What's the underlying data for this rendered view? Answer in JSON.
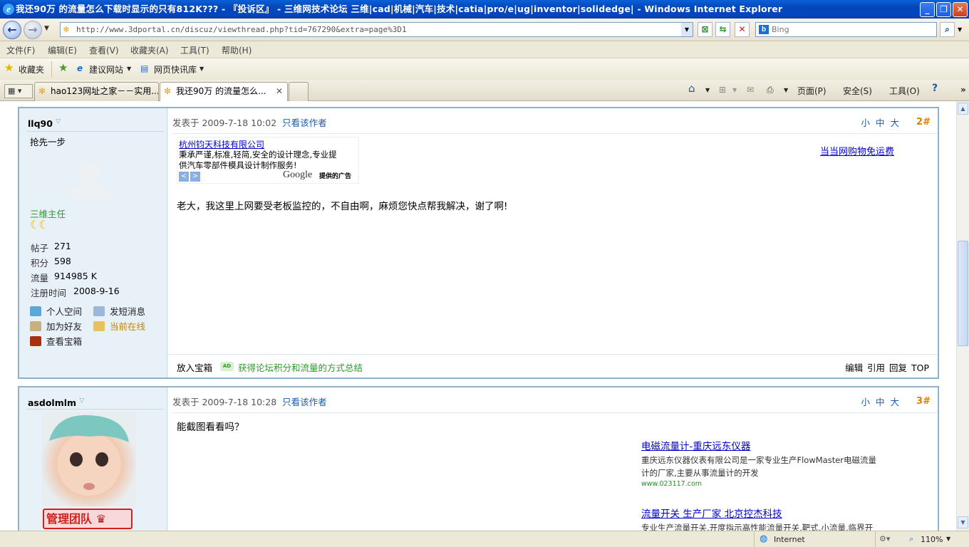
{
  "window": {
    "title": "我还90万 的流量怎么下载时显示的只有812K??? - 『投诉区』 - 三维网技术论坛 三维|cad|机械|汽车|技术|catia|pro/e|ug|inventor|solidedge| - Windows Internet Explorer",
    "min": "_",
    "restore": "❐",
    "close": "✕"
  },
  "address": {
    "url": "http://www.3dportal.cn/discuz/viewthread.php?tid=767290&extra=page%3D1",
    "search_placeholder": "Bing",
    "search_icon": "magnifier-icon"
  },
  "menu": [
    "文件(F)",
    "编辑(E)",
    "查看(V)",
    "收藏夹(A)",
    "工具(T)",
    "帮助(H)"
  ],
  "favbar": {
    "favorites": "收藏夹",
    "suggested": "建议网站",
    "slices": "网页快讯库"
  },
  "tabs": [
    {
      "label": "hao123网址之家－－实用..."
    },
    {
      "label": "我还90万 的流量怎么..."
    }
  ],
  "commands": {
    "page": "页面(P)",
    "safety": "安全(S)",
    "tools": "工具(O)"
  },
  "posts": [
    {
      "author": "llq90",
      "tagline": "抢先一步",
      "rank": "三维主任",
      "stats": [
        {
          "k": "帖子",
          "v": "271"
        },
        {
          "k": "积分",
          "v": "598"
        },
        {
          "k": "流量",
          "v": "914985 K"
        },
        {
          "k": "注册时间",
          "v": "2008-9-16"
        }
      ],
      "actions": [
        "个人空间",
        "发短消息",
        "加为好友",
        "当前在线",
        "查看宝箱"
      ],
      "posted": "发表于 2009-7-18 10:02",
      "only_author": "只看该作者",
      "font_sizes": "小中大",
      "floor": "2#",
      "ad": {
        "title": "杭州钧天科技有限公司",
        "line1": "秉承严谨,标准,轻简,安全的设计理念,专业提",
        "line2": "供汽车零部件模具设计制作服务!",
        "google": "Google",
        "google_note": "提供的广告"
      },
      "promo": "当当网购物免运费",
      "body": "老大，我这里上网要受老板监控的，不自由啊，麻烦您快点帮我解决，谢了啊!",
      "footer_left": "放入宝箱",
      "footer_link": "获得论坛积分和流量的方式总结",
      "footer_badge": "AD",
      "footer_right": "编辑 引用 回复 TOP"
    },
    {
      "author": "asdolmlm",
      "badge": "管理团队",
      "posted": "发表于 2009-7-18 10:28",
      "only_author": "只看该作者",
      "font_sizes": "小中大",
      "floor": "3#",
      "body": "能截图看看吗？",
      "ads": [
        {
          "title": "电磁流量计-重庆远东仪器",
          "desc1": "重庆远东仪器仪表有限公司是一家专业生产FlowMaster电磁流量",
          "desc2": "计的厂家,主要从事流量计的开发",
          "url": "www.023117.com"
        },
        {
          "title": "流量开关 生产厂家 北京控杰科技",
          "desc1": "专业生产流量开关,开度指示高性能流量开关,靶式,小流量,临界开"
        }
      ]
    }
  ],
  "status": {
    "zone": "Internet",
    "zoom": "110%"
  }
}
